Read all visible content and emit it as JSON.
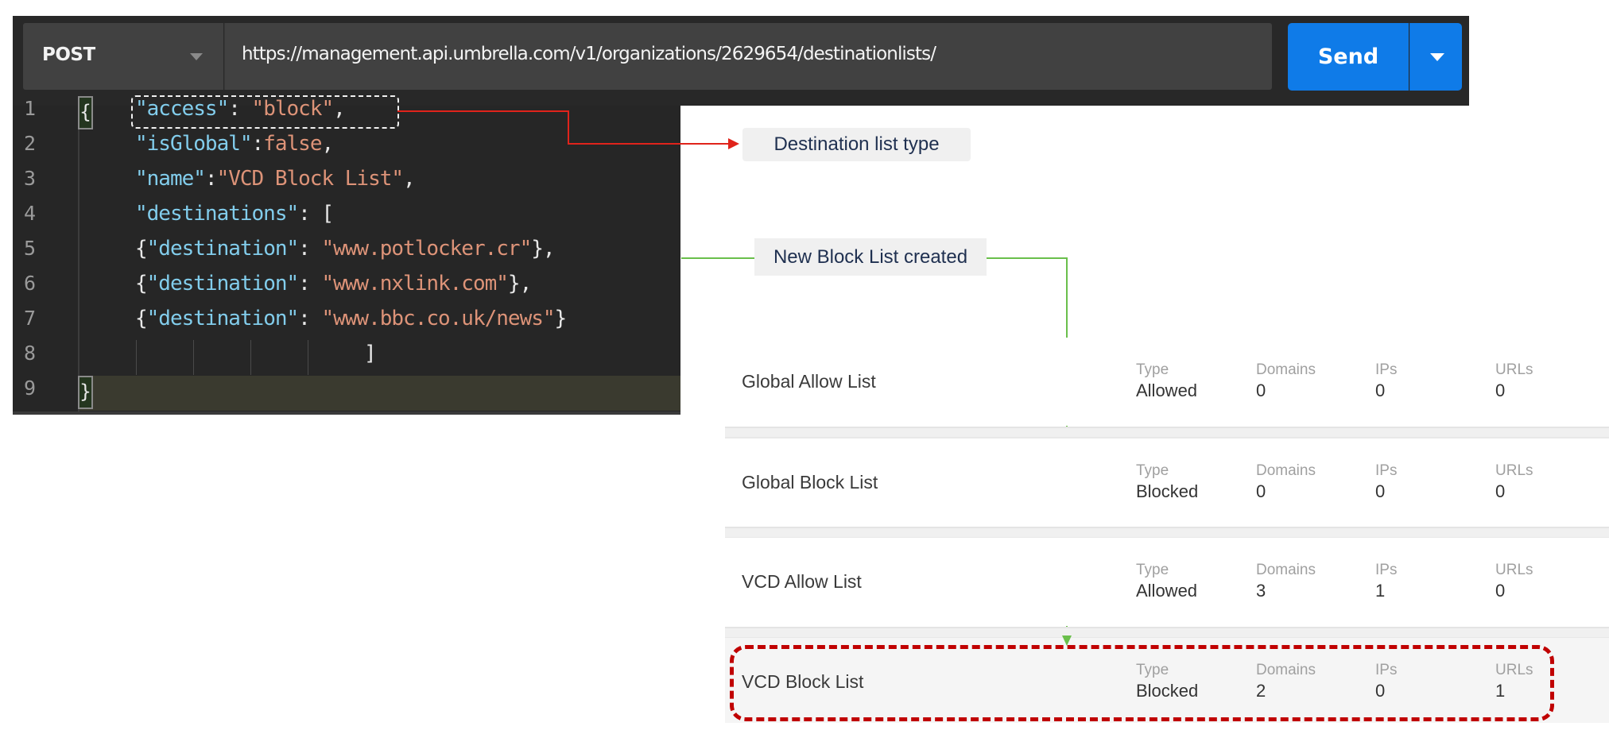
{
  "request": {
    "method": "POST",
    "url": "https://management.api.umbrella.com/v1/organizations/2629654/destinationlists/",
    "send_label": "Send",
    "method_caret_icon": "caret-down",
    "send_menu_icon": "caret-down"
  },
  "editor": {
    "line_numbers": [
      "1",
      "2",
      "3",
      "4",
      "5",
      "6",
      "7",
      "8",
      "9"
    ],
    "lines": [
      {
        "open": "{",
        "key": "\"access\"",
        "sep": ": ",
        "value": "\"block\"",
        "tail": ","
      },
      {
        "key": "\"isGlobal\"",
        "sep": ":",
        "value": "false",
        "tail": ","
      },
      {
        "key": "\"name\"",
        "sep": ":",
        "value": "\"VCD Block List\"",
        "tail": ","
      },
      {
        "key": "\"destinations\"",
        "sep": ": ",
        "value": "",
        "tail": "["
      },
      {
        "pre": "{",
        "key": "\"destination\"",
        "sep": ": ",
        "value": "\"www.potlocker.cr\"",
        "tail": "},"
      },
      {
        "pre": "{",
        "key": "\"destination\"",
        "sep": ": ",
        "value": "\"www.nxlink.com\"",
        "tail": "},"
      },
      {
        "pre": "{",
        "key": "\"destination\"",
        "sep": ": ",
        "value": "\"www.bbc.co.uk/news\"",
        "tail": "}"
      },
      {
        "tail": "]"
      },
      {
        "close": "}"
      }
    ]
  },
  "callouts": {
    "type": "Destination list type",
    "created": "New Block List created"
  },
  "destination_lists": {
    "column_labels": {
      "type": "Type",
      "domains": "Domains",
      "ips": "IPs",
      "urls": "URLs"
    },
    "rows": [
      {
        "name": "Global Allow List",
        "type": "Allowed",
        "domains": "0",
        "ips": "0",
        "urls": "0"
      },
      {
        "name": "Global Block List",
        "type": "Blocked",
        "domains": "0",
        "ips": "0",
        "urls": "0"
      },
      {
        "name": "VCD Allow List",
        "type": "Allowed",
        "domains": "3",
        "ips": "1",
        "urls": "0"
      },
      {
        "name": "VCD Block List",
        "type": "Blocked",
        "domains": "2",
        "ips": "0",
        "urls": "1",
        "highlighted": true
      }
    ]
  },
  "colors": {
    "send_button": "#0f7be8",
    "type_arrow": "#e0231b",
    "created_arrow": "#6abf4b",
    "highlight_dash": "#c00000",
    "json_key": "#82cdec",
    "json_value": "#dd9378"
  }
}
